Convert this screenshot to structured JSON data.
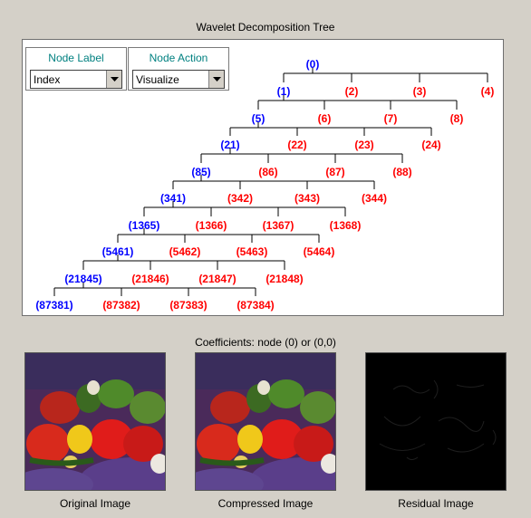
{
  "tree": {
    "title": "Wavelet Decomposition Tree",
    "nodes": [
      [
        "(0)"
      ],
      [
        "(1)",
        "(2)",
        "(3)",
        "(4)"
      ],
      [
        "(5)",
        "(6)",
        "(7)",
        "(8)"
      ],
      [
        "(21)",
        "(22)",
        "(23)",
        "(24)"
      ],
      [
        "(85)",
        "(86)",
        "(87)",
        "(88)"
      ],
      [
        "(341)",
        "(342)",
        "(343)",
        "(344)"
      ],
      [
        "(1365)",
        "(1366)",
        "(1367)",
        "(1368)"
      ],
      [
        "(5461)",
        "(5462)",
        "(5463)",
        "(5464)"
      ],
      [
        "(21845)",
        "(21846)",
        "(21847)",
        "(21848)"
      ],
      [
        "(87381)",
        "(87382)",
        "(87383)",
        "(87384)"
      ]
    ],
    "colors": {
      "expanded": "#0000ff",
      "leaf": "#ff0000"
    }
  },
  "controls": {
    "node_label": {
      "title": "Node Label",
      "value": "Index"
    },
    "node_action": {
      "title": "Node Action",
      "value": "Visualize"
    }
  },
  "coefficients": {
    "title": "Coefficients: node (0) or (0,0)"
  },
  "images": {
    "original": "Original Image",
    "compressed": "Compressed Image",
    "residual": "Residual Image"
  }
}
